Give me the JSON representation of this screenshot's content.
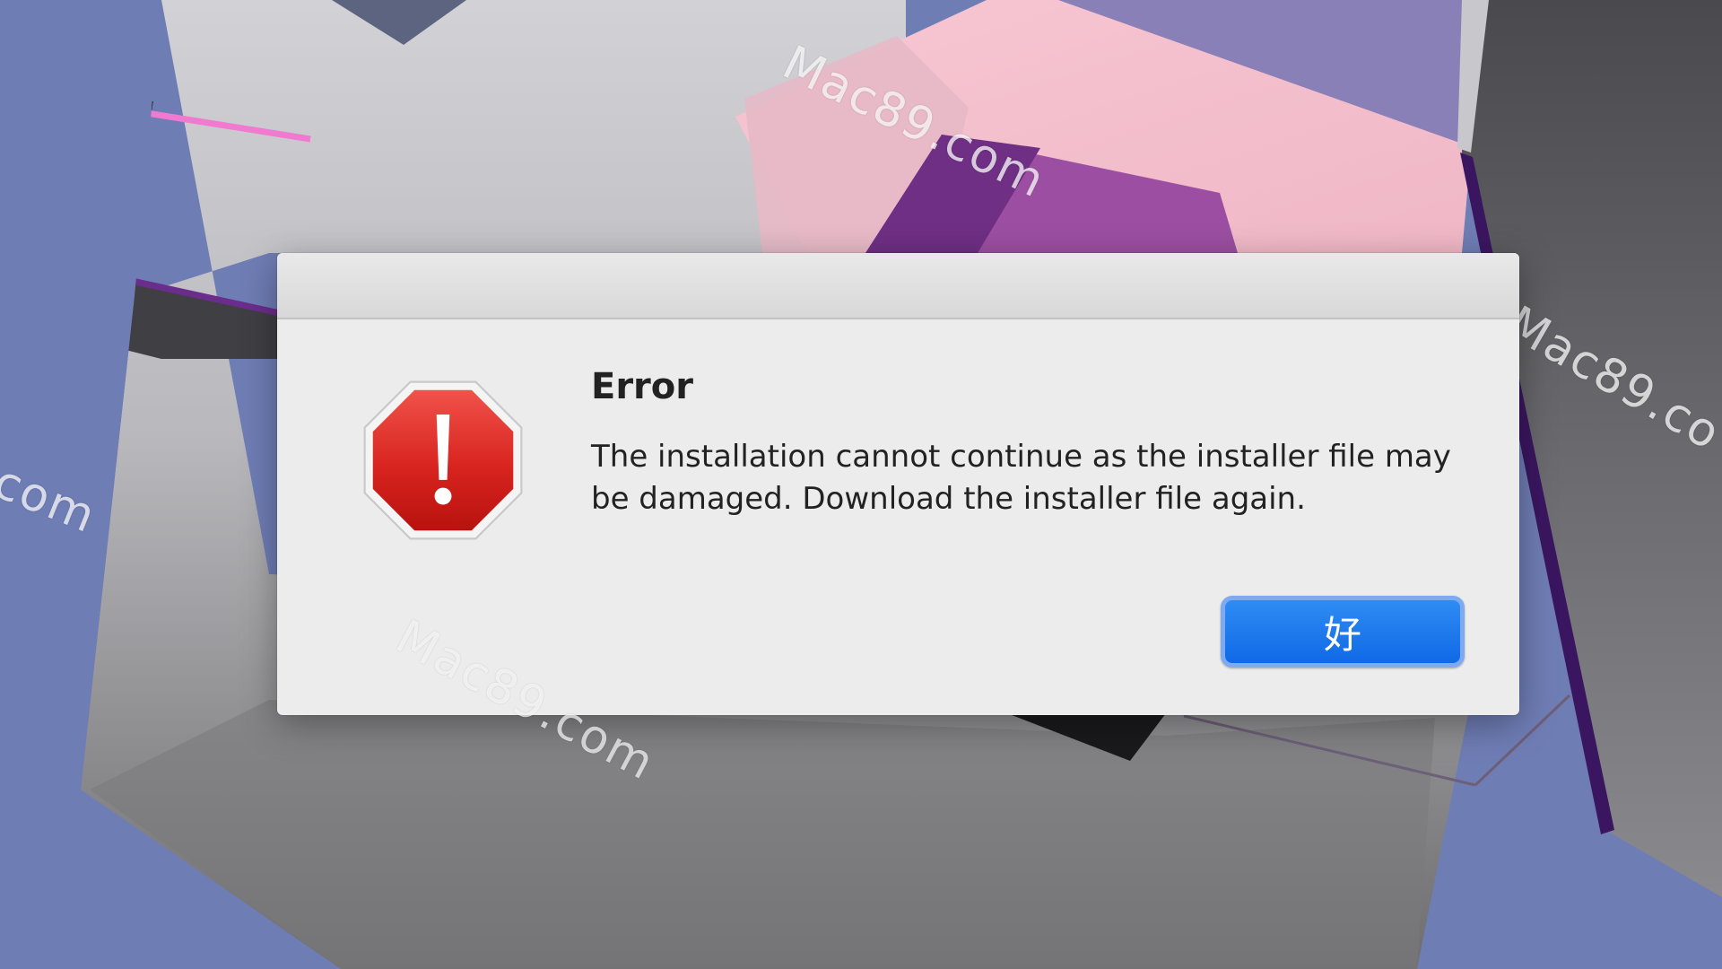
{
  "dialog": {
    "title": "Error",
    "message": "The installation cannot continue as the installer file may be damaged. Download the installer file again.",
    "ok_label": "好",
    "icon": "stop-alert-icon"
  },
  "watermarks": {
    "wm1": "Mac89.com",
    "wm2": "Mac89.co",
    "wm3": ".com",
    "wm4": "Mac89.com"
  },
  "colors": {
    "button_blue": "#1a75ef",
    "alert_red": "#d8241f",
    "dialog_bg": "#ececec"
  }
}
